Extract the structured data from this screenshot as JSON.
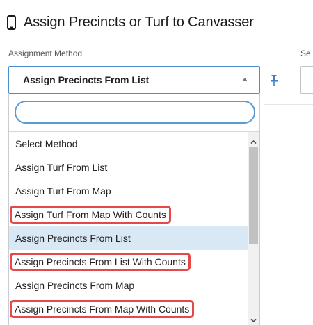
{
  "header": {
    "title": "Assign Precincts or Turf to Canvasser",
    "icon": "mobile-phone-icon"
  },
  "assignment_method": {
    "label": "Assignment Method",
    "selected_value": "Assign Precincts From List",
    "search": {
      "value": "",
      "placeholder": ""
    },
    "options": [
      {
        "label": "Select Method",
        "selected": false,
        "highlighted": false
      },
      {
        "label": "Assign Turf From List",
        "selected": false,
        "highlighted": false
      },
      {
        "label": "Assign Turf From Map",
        "selected": false,
        "highlighted": false
      },
      {
        "label": "Assign Turf From Map With Counts",
        "selected": false,
        "highlighted": true
      },
      {
        "label": "Assign Precincts From List",
        "selected": true,
        "highlighted": false
      },
      {
        "label": "Assign Precincts From List With Counts",
        "selected": false,
        "highlighted": true
      },
      {
        "label": "Assign Precincts From Map",
        "selected": false,
        "highlighted": false
      },
      {
        "label": "Assign Precincts From Map With Counts",
        "selected": false,
        "highlighted": true
      }
    ]
  },
  "second_field": {
    "label": "Se"
  },
  "colors": {
    "accent": "#4a8fd4",
    "selected_row": "#d9e8f5",
    "highlight_box": "#e44848"
  }
}
